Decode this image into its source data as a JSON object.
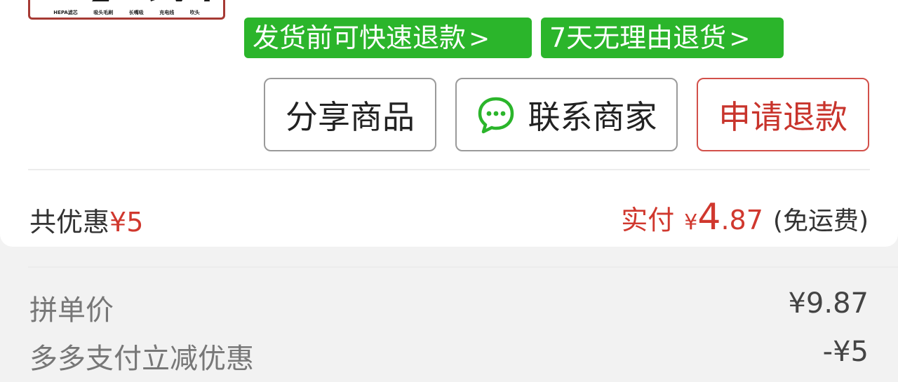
{
  "thumbnail": {
    "captions": [
      "HEPA滤芯",
      "吸头毛刷",
      "长嘴吸",
      "充电线",
      "吹头"
    ]
  },
  "tags": {
    "fast_refund": "发货前可快速退款",
    "seven_day_return": "7天无理由退货",
    "chevron_icon": "chevron-right"
  },
  "actions": {
    "share": "分享商品",
    "contact": "联系商家",
    "contact_icon": "chat-bubble",
    "refund": "申请退款"
  },
  "summary": {
    "discount_label": "共优惠",
    "discount_amount": "¥5",
    "paid_label": "实付",
    "paid_currency": "¥",
    "paid_int": "4",
    "paid_dec": ".87",
    "shipping_note": "(免运费)"
  },
  "details": [
    {
      "label": "拼单价",
      "value": "¥9.87"
    },
    {
      "label": "多多支付立减优惠",
      "value": "-¥5"
    }
  ],
  "colors": {
    "green": "#2bb52b",
    "red": "#d0382e",
    "refund_border": "#d2504a"
  }
}
